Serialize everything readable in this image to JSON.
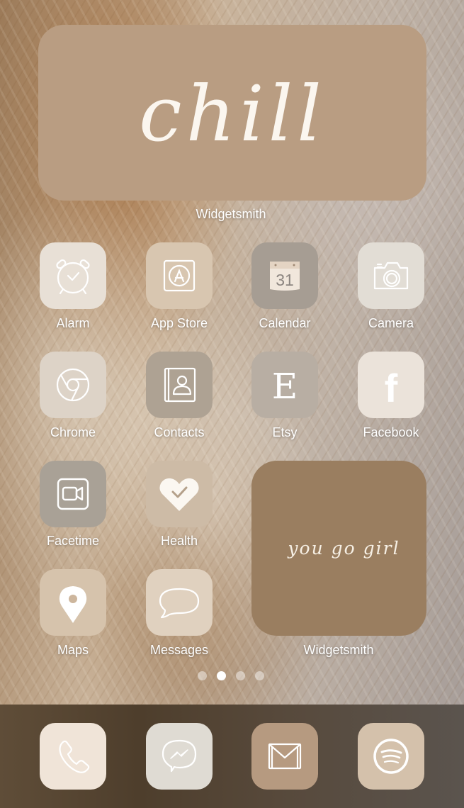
{
  "widgets": {
    "large": {
      "text": "chill",
      "label": "Widgetsmith",
      "color": "#b99d82"
    },
    "medium": {
      "text": "you go girl",
      "label": "Widgetsmith",
      "color": "#9a7e60"
    }
  },
  "apps": [
    {
      "label": "Alarm",
      "icon": "alarm-clock-icon",
      "bg": "#e8e0d6"
    },
    {
      "label": "App Store",
      "icon": "app-store-icon",
      "bg": "#d8c6b0"
    },
    {
      "label": "Calendar",
      "icon": "calendar-icon",
      "bg": "#a69d93",
      "date": "31"
    },
    {
      "label": "Camera",
      "icon": "camera-icon",
      "bg": "#e2ddd5"
    },
    {
      "label": "Chrome",
      "icon": "chrome-icon",
      "bg": "#ddd3c7"
    },
    {
      "label": "Contacts",
      "icon": "contacts-book-icon",
      "bg": "#aea293"
    },
    {
      "label": "Etsy",
      "icon": "etsy-e-icon",
      "bg": "#b8aea3",
      "glyph": "E"
    },
    {
      "label": "Facebook",
      "icon": "facebook-f-icon",
      "bg": "#ebe3da",
      "glyph": "f"
    },
    {
      "label": "Facetime",
      "icon": "video-camera-icon",
      "bg": "#a9a196"
    },
    {
      "label": "Health",
      "icon": "heart-check-icon",
      "bg": "#cdbba6"
    },
    {
      "label": "Maps",
      "icon": "map-pin-icon",
      "bg": "#d6c3ac"
    },
    {
      "label": "Messages",
      "icon": "speech-bubble-icon",
      "bg": "#e0d1bf"
    }
  ],
  "page_dots": {
    "count": 4,
    "active_index": 1
  },
  "dock": [
    {
      "label": "Phone",
      "icon": "phone-icon",
      "bg": "#f0e4d8"
    },
    {
      "label": "Messenger",
      "icon": "messenger-icon",
      "bg": "#dfdbd3"
    },
    {
      "label": "Gmail",
      "icon": "mail-envelope-icon",
      "bg": "#b69a80"
    },
    {
      "label": "Spotify",
      "icon": "spotify-icon",
      "bg": "#d4c1ab"
    }
  ]
}
